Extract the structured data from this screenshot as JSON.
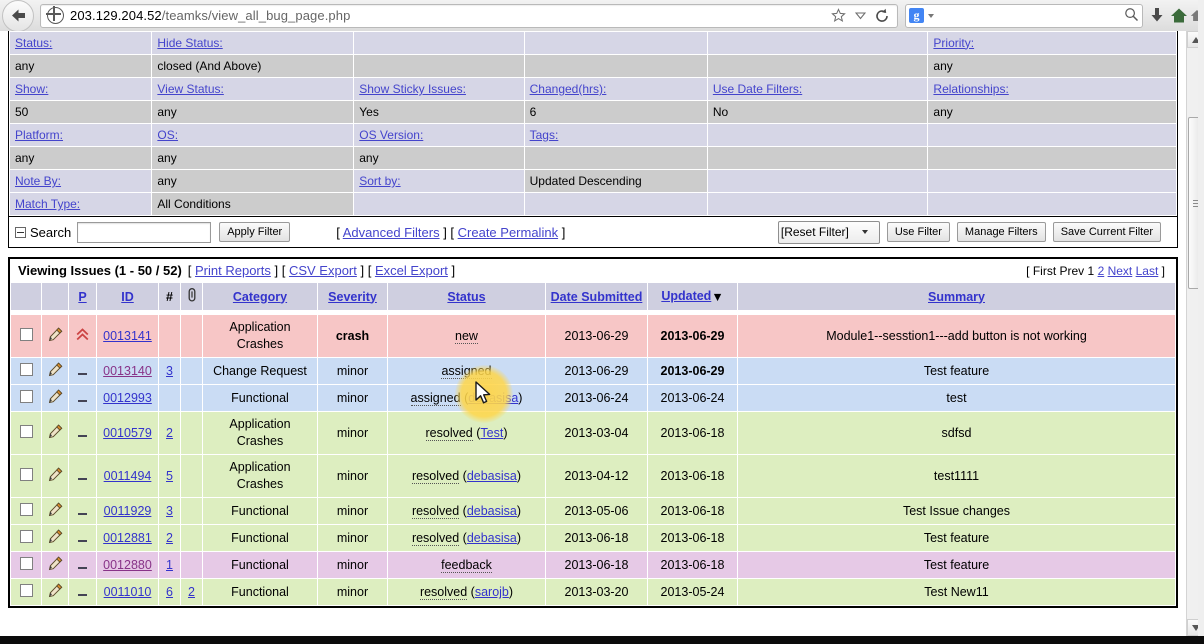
{
  "browser": {
    "back_icon": "back-arrow-icon",
    "url_host": "203.129.204.52",
    "url_path": "/teamks/view_all_bug_page.php",
    "star_icon": "bookmark-star-icon",
    "caret_icon": "chevron-down-icon",
    "reload_icon": "reload-icon",
    "search_engine_icon": "google-icon",
    "search_placeholder": "",
    "search_value": "",
    "magnifier_icon": "search-icon",
    "download_icon": "download-icon",
    "home_icon": "home-icon"
  },
  "filter": {
    "rows": [
      {
        "cells": [
          {
            "type": "link",
            "text": "Status:"
          },
          {
            "type": "link",
            "text": "Hide Status:"
          },
          {
            "type": "blank",
            "text": ""
          },
          {
            "type": "blank",
            "text": ""
          },
          {
            "type": "blank",
            "text": ""
          },
          {
            "type": "link",
            "text": "Priority:"
          }
        ]
      },
      {
        "cells": [
          {
            "type": "val",
            "text": "any"
          },
          {
            "type": "val",
            "text": "closed (And Above)"
          },
          {
            "type": "val",
            "text": ""
          },
          {
            "type": "val",
            "text": ""
          },
          {
            "type": "val",
            "text": ""
          },
          {
            "type": "val",
            "text": "any"
          }
        ]
      },
      {
        "cells": [
          {
            "type": "link",
            "text": "Show:"
          },
          {
            "type": "link",
            "text": "View Status:"
          },
          {
            "type": "link",
            "text": "Show Sticky Issues:"
          },
          {
            "type": "link",
            "text": "Changed(hrs):"
          },
          {
            "type": "link",
            "text": "Use Date Filters:"
          },
          {
            "type": "link",
            "text": "Relationships:"
          }
        ]
      },
      {
        "cells": [
          {
            "type": "val",
            "text": "50"
          },
          {
            "type": "val",
            "text": "any"
          },
          {
            "type": "val",
            "text": "Yes"
          },
          {
            "type": "val",
            "text": "6"
          },
          {
            "type": "val",
            "text": "No"
          },
          {
            "type": "val",
            "text": "any"
          }
        ]
      },
      {
        "cells": [
          {
            "type": "link",
            "text": "Platform:"
          },
          {
            "type": "link",
            "text": "OS:"
          },
          {
            "type": "link",
            "text": "OS Version:"
          },
          {
            "type": "link",
            "text": "Tags:"
          },
          {
            "type": "blank",
            "text": ""
          },
          {
            "type": "blank",
            "text": ""
          }
        ]
      },
      {
        "cells": [
          {
            "type": "val",
            "text": "any"
          },
          {
            "type": "val",
            "text": "any"
          },
          {
            "type": "val",
            "text": "any"
          },
          {
            "type": "val",
            "text": ""
          },
          {
            "type": "val",
            "text": ""
          },
          {
            "type": "val",
            "text": ""
          }
        ]
      },
      {
        "cells": [
          {
            "type": "link",
            "text": "Note By:"
          },
          {
            "type": "val",
            "text": "any"
          },
          {
            "type": "link",
            "text": "Sort by:"
          },
          {
            "type": "val",
            "text": "Updated Descending"
          },
          {
            "type": "blank",
            "text": ""
          },
          {
            "type": "blank",
            "text": ""
          }
        ]
      },
      {
        "cells": [
          {
            "type": "link",
            "text": "Match Type:"
          },
          {
            "type": "val",
            "text": "All Conditions"
          },
          {
            "type": "blank",
            "text": ""
          },
          {
            "type": "blank",
            "text": ""
          },
          {
            "type": "blank",
            "text": ""
          },
          {
            "type": "blank",
            "text": ""
          }
        ]
      }
    ],
    "search_label": "Search",
    "search_value": "",
    "apply_filter_label": "Apply Filter",
    "advanced_filters_label": "Advanced Filters",
    "create_permalink_label": "Create Permalink",
    "reset_filter_label": "[Reset Filter]",
    "use_filter_label": "Use Filter",
    "manage_filters_label": "Manage Filters",
    "save_current_filter_label": "Save Current Filter"
  },
  "issues": {
    "title": "Viewing Issues (1 - 50 / 52)",
    "print_reports_label": "Print Reports",
    "csv_export_label": "CSV Export",
    "excel_export_label": "Excel Export",
    "pager": {
      "open": "[",
      "first": "First",
      "prev": "Prev",
      "page1": "1",
      "page2": "2",
      "next": "Next",
      "last": "Last",
      "close": "]"
    },
    "columns": {
      "p": "P",
      "id": "ID",
      "notes": "#",
      "attach": "attachment-icon",
      "category": "Category",
      "severity": "Severity",
      "status": "Status",
      "date_submitted": "Date Submitted",
      "updated": "Updated",
      "updated_sort_icon": "sort-descending-icon",
      "summary": "Summary"
    },
    "rows": [
      {
        "style": "r-new",
        "priority": "high",
        "id": "0013141",
        "id_visited": false,
        "notes": "",
        "attach": "",
        "category": "Application Crashes",
        "severity": "crash",
        "severity_bold": true,
        "status": "new",
        "handler": "",
        "date_submitted": "2013-06-29",
        "updated": "2013-06-29",
        "updated_bold": true,
        "summary": "Module1--sesstion1---add button is not working"
      },
      {
        "style": "r-assign",
        "priority": "none",
        "id": "0013140",
        "id_visited": true,
        "notes": "3",
        "attach": "",
        "category": "Change Request",
        "severity": "minor",
        "severity_bold": false,
        "status": "assigned",
        "handler": "",
        "date_submitted": "2013-06-29",
        "updated": "2013-06-29",
        "updated_bold": true,
        "summary": "Test feature"
      },
      {
        "style": "r-assign",
        "priority": "none",
        "id": "0012993",
        "id_visited": false,
        "notes": "",
        "attach": "",
        "category": "Functional",
        "severity": "minor",
        "severity_bold": false,
        "status": "assigned",
        "handler": "debasisa",
        "date_submitted": "2013-06-24",
        "updated": "2013-06-24",
        "updated_bold": false,
        "summary": "test"
      },
      {
        "style": "r-resolve",
        "priority": "none",
        "id": "0010579",
        "id_visited": false,
        "notes": "2",
        "attach": "",
        "category": "Application Crashes",
        "severity": "minor",
        "severity_bold": false,
        "status": "resolved",
        "handler": "Test",
        "date_submitted": "2013-03-04",
        "updated": "2013-06-18",
        "updated_bold": false,
        "summary": "sdfsd"
      },
      {
        "style": "r-resolve",
        "priority": "none",
        "id": "0011494",
        "id_visited": false,
        "notes": "5",
        "attach": "",
        "category": "Application Crashes",
        "severity": "minor",
        "severity_bold": false,
        "status": "resolved",
        "handler": "debasisa",
        "date_submitted": "2013-04-12",
        "updated": "2013-06-18",
        "updated_bold": false,
        "summary": "test1111"
      },
      {
        "style": "r-resolve",
        "priority": "none",
        "id": "0011929",
        "id_visited": false,
        "notes": "3",
        "attach": "",
        "category": "Functional",
        "severity": "minor",
        "severity_bold": false,
        "status": "resolved",
        "handler": "debasisa",
        "date_submitted": "2013-05-06",
        "updated": "2013-06-18",
        "updated_bold": false,
        "summary": "Test Issue changes"
      },
      {
        "style": "r-resolve",
        "priority": "none",
        "id": "0012881",
        "id_visited": false,
        "notes": "2",
        "attach": "",
        "category": "Functional",
        "severity": "minor",
        "severity_bold": false,
        "status": "resolved",
        "handler": "debasisa",
        "date_submitted": "2013-06-18",
        "updated": "2013-06-18",
        "updated_bold": false,
        "summary": "Test feature"
      },
      {
        "style": "r-feedback",
        "priority": "none",
        "id": "0012880",
        "id_visited": true,
        "notes": "1",
        "attach": "",
        "category": "Functional",
        "severity": "minor",
        "severity_bold": false,
        "status": "feedback",
        "handler": "",
        "date_submitted": "2013-06-18",
        "updated": "2013-06-18",
        "updated_bold": false,
        "summary": "Test feature"
      },
      {
        "style": "r-resolve",
        "priority": "none",
        "id": "0011010",
        "id_visited": false,
        "notes": "6",
        "attach": "2",
        "category": "Functional",
        "severity": "minor",
        "severity_bold": false,
        "status": "resolved",
        "handler": "sarojb",
        "date_submitted": "2013-03-20",
        "updated": "2013-05-24",
        "updated_bold": false,
        "summary": "Test New11"
      }
    ]
  },
  "colors": {
    "link": "#3333cc",
    "visited_link": "#883388",
    "row_new": "#f7c6c6",
    "row_assigned": "#cadcf4",
    "row_resolved": "#ddeec0",
    "row_feedback": "#e6c9e6",
    "header_bg": "#cfcfe0",
    "highlight": "#ffd64a"
  }
}
